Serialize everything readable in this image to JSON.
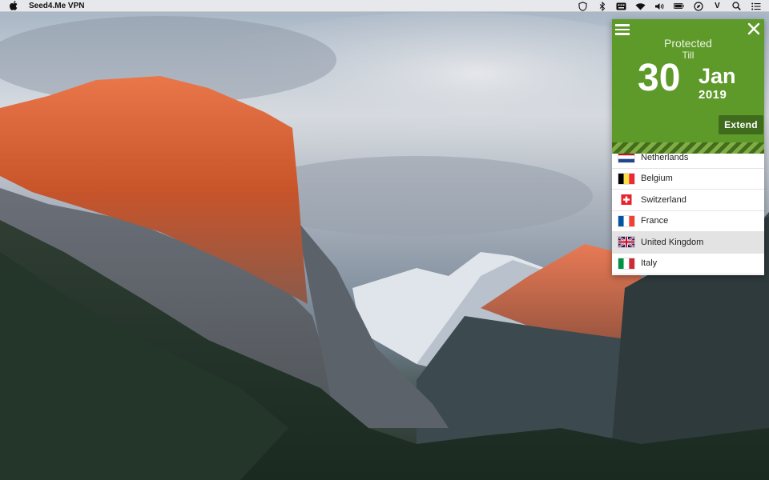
{
  "menubar": {
    "apple_icon": "apple-logo-icon",
    "app_name": "Seed4.Me VPN",
    "status_icons": [
      "shield-icon",
      "bluetooth-icon",
      "input-menu-icon",
      "wifi-icon",
      "volume-icon",
      "battery-icon",
      "compass-icon",
      "v-app-icon",
      "spotlight-search-icon",
      "notification-center-icon"
    ],
    "v_letter": "V"
  },
  "vpn": {
    "protected_label": "Protected",
    "till_label": "Till",
    "day": "30",
    "month": "Jan",
    "year": "2019",
    "extend_label": "Extend",
    "header_color": "#5e9a2a",
    "countries": [
      {
        "name": "Netherlands",
        "flag": "netherlands-flag-icon",
        "selected": false
      },
      {
        "name": "Belgium",
        "flag": "belgium-flag-icon",
        "selected": false
      },
      {
        "name": "Switzerland",
        "flag": "switzerland-flag-icon",
        "selected": false
      },
      {
        "name": "France",
        "flag": "france-flag-icon",
        "selected": false
      },
      {
        "name": "United Kingdom",
        "flag": "united-kingdom-flag-icon",
        "selected": true
      },
      {
        "name": "Italy",
        "flag": "italy-flag-icon",
        "selected": false
      }
    ]
  }
}
